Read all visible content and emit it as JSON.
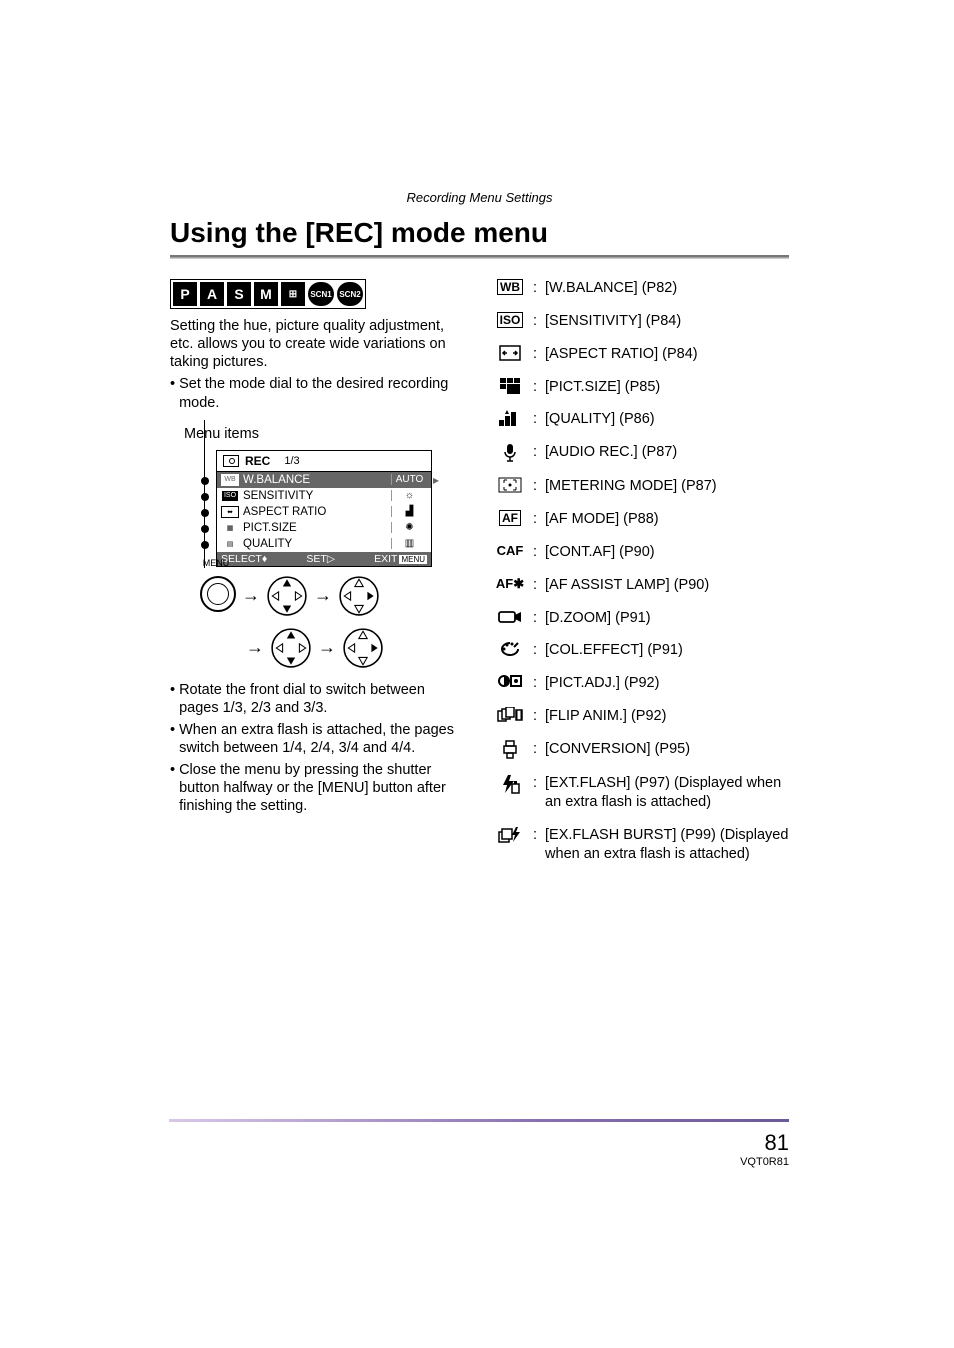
{
  "header_label": "Recording Menu Settings",
  "title": "Using the [REC] mode menu",
  "modes": [
    "P",
    "A",
    "S",
    "M",
    "⊞",
    "SCN1",
    "SCN2"
  ],
  "intro": "Setting the hue, picture quality adjustment, etc. allows you to create wide variations on taking pictures.",
  "intro_bullet": "Set the mode dial to the desired recording mode.",
  "menu_items_label": "Menu items",
  "menu_screen": {
    "rec": "REC",
    "page": "1/3",
    "rows": [
      {
        "label": "W.BALANCE",
        "value": "AUTO",
        "hl": true
      },
      {
        "label": "SENSITIVITY",
        "value": "☼"
      },
      {
        "label": "ASPECT RATIO",
        "value": "▟"
      },
      {
        "label": "PICT.SIZE",
        "value": "✺"
      },
      {
        "label": "QUALITY",
        "value": "▥"
      }
    ],
    "bottom": {
      "select": "SELECT",
      "set": "SET",
      "exit": "EXIT",
      "menu": "MENU"
    }
  },
  "nav_menu_label": "MENU",
  "left_bullets": [
    "Rotate the front dial to switch between pages 1/3, 2/3 and 3/3.",
    "When an extra flash is attached, the pages switch between 1/4, 2/4, 3/4 and 4/4.",
    "Close the menu by pressing the shutter button halfway or the [MENU] button after finishing the setting."
  ],
  "items": [
    {
      "icon_type": "box",
      "icon": "WB",
      "text": "[W.BALANCE] (P82)"
    },
    {
      "icon_type": "box",
      "icon": "ISO",
      "text": "[SENSITIVITY] (P84)"
    },
    {
      "icon_type": "aspect",
      "icon": "",
      "text": "[ASPECT RATIO] (P84)"
    },
    {
      "icon_type": "pictsize",
      "icon": "",
      "text": "[PICT.SIZE] (P85)"
    },
    {
      "icon_type": "quality",
      "icon": "",
      "text": "[QUALITY] (P86)"
    },
    {
      "icon_type": "mic",
      "icon": "",
      "text": "[AUDIO REC.] (P87)"
    },
    {
      "icon_type": "metering",
      "icon": "",
      "text": "[METERING MODE] (P87)"
    },
    {
      "icon_type": "box",
      "icon": "AF",
      "text": "[AF MODE] (P88)"
    },
    {
      "icon_type": "text",
      "icon": "CAF",
      "text": "[CONT.AF] (P90)"
    },
    {
      "icon_type": "text",
      "icon": "AF✱",
      "text": "[AF ASSIST LAMP] (P90)"
    },
    {
      "icon_type": "dzoom",
      "icon": "",
      "text": "[D.ZOOM] (P91)"
    },
    {
      "icon_type": "coleffect",
      "icon": "",
      "text": "[COL.EFFECT] (P91)"
    },
    {
      "icon_type": "pictadj",
      "icon": "",
      "text": "[PICT.ADJ.] (P92)"
    },
    {
      "icon_type": "flipanim",
      "icon": "",
      "text": "[FLIP ANIM.] (P92)"
    },
    {
      "icon_type": "conversion",
      "icon": "",
      "text": "[CONVERSION] (P95)"
    },
    {
      "icon_type": "extflash",
      "icon": "",
      "text": "[EXT.FLASH] (P97) (Displayed when an extra flash is attached)"
    },
    {
      "icon_type": "exflashburst",
      "icon": "",
      "text": "[EX.FLASH BURST] (P99) (Displayed when an extra flash is attached)"
    }
  ],
  "page_num": "81",
  "doc_id": "VQT0R81"
}
